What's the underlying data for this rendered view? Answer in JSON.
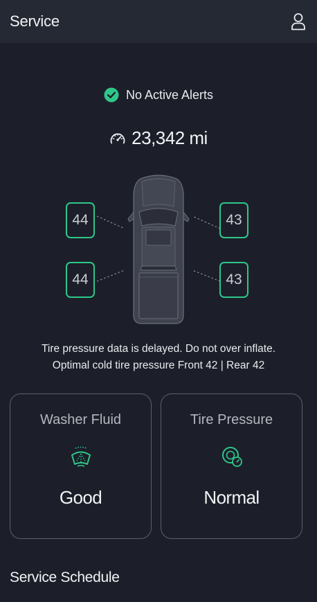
{
  "header": {
    "title": "Service",
    "profile_icon": "user-icon"
  },
  "alerts": {
    "icon": "check-circle-icon",
    "text": "No Active Alerts",
    "color": "#2ec78a"
  },
  "odometer": {
    "icon": "speedometer-icon",
    "value": "23,342 mi"
  },
  "tires": {
    "front_left": "44",
    "front_right": "43",
    "rear_left": "44",
    "rear_right": "43",
    "status_color": "#2ec78a"
  },
  "info": {
    "line1": "Tire pressure data is delayed. Do not over inflate.",
    "line2": "Optimal cold tire pressure Front 42 | Rear 42"
  },
  "cards": {
    "washer": {
      "title": "Washer Fluid",
      "icon": "windshield-washer-icon",
      "status": "Good"
    },
    "tire": {
      "title": "Tire Pressure",
      "icon": "tire-pressure-icon",
      "status": "Normal"
    }
  },
  "sections": {
    "service_schedule": "Service Schedule"
  }
}
